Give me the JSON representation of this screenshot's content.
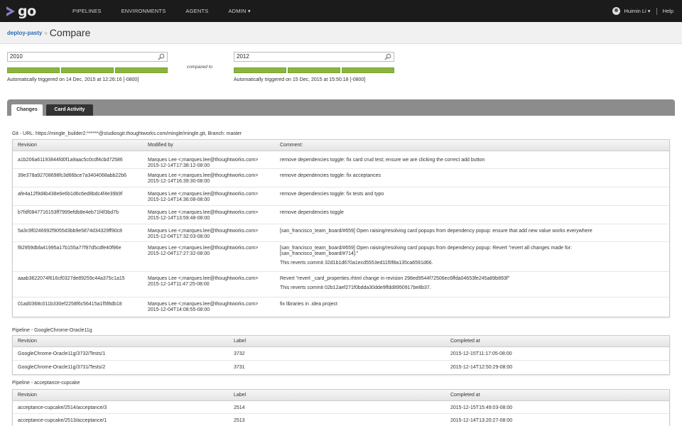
{
  "nav": {
    "logo_text": "go",
    "items": [
      "PIPELINES",
      "ENVIRONMENTS",
      "AGENTS",
      "ADMIN ▾"
    ],
    "user_name": "Huimin Li ▾",
    "help": "Help"
  },
  "header": {
    "breadcrumb": "deploy-pasty",
    "separator": "»",
    "title": "Compare"
  },
  "compare": {
    "left": {
      "value": "2010",
      "triggered": "Automatically triggered on 14 Dec, 2015 at 12:26:16 [-0800]"
    },
    "middle_label": "compared to",
    "right": {
      "value": "2012",
      "triggered": "Automatically triggered on 15 Dec, 2015 at 15:50:18 [-0800]"
    },
    "stage_color": "#8bb53e"
  },
  "tabs": [
    "Changes",
    "Card Activity"
  ],
  "git": {
    "label": "Git - URL: https://mingle_builder2:******@studiosgit.thoughtworks.com/mingle/mingle.git, Branch: master",
    "headers": [
      "Revision",
      "Modified by",
      "Comment:"
    ],
    "rows": [
      {
        "rev": "a1b206a61193844fd0f1a9aac5c0cdf4cbd72586",
        "by": "Marques Lee <;marques.lee@thoughtworks.com>",
        "date": "2015-12-14T17:38:12-08:00",
        "comment": "remove dependencies toggle: fix card crud test; ensure we are clicking the correct add button",
        "extra": ""
      },
      {
        "rev": "39e378a92708698fc3d66bce7a3404068abb22b6",
        "by": "Marques Lee <;marques.lee@thoughtworks.com>",
        "date": "2015-12-14T16:39:30-08:00",
        "comment": "remove dependencies toggle: fix acceptances",
        "extra": ""
      },
      {
        "rev": "afe4a12f9d4b438e6e6b1d6c6ed8bdc4f4e39b9f",
        "by": "Marques Lee <;marques.lee@thoughtworks.com>",
        "date": "2015-12-14T14:36:08-08:00",
        "comment": "remove dependencies toggle: fix tests and typo",
        "extra": ""
      },
      {
        "rev": "b7fdf0847716153ff7999efdb8e4eb71f4f3bd7b",
        "by": "Marques Lee <;marques.lee@thoughtworks.com>",
        "date": "2015-12-14T13:59:48-08:00",
        "comment": "remove dependencies toggle",
        "extra": ""
      },
      {
        "rev": "5a3c9f0246992f9055d3bb9e5874d34329ff90c8",
        "by": "Marques Lee <;marques.lee@thoughtworks.com>",
        "date": "2015-12-04T17:32:03-08:00",
        "comment": "[san_francisco_team_board/#659] Open raising/resolving card popups from dependency popup: ensure that add new value works everywhere",
        "extra": ""
      },
      {
        "rev": "f82959dbfa41995a17b155a77f97d5cdfe40f96e",
        "by": "Marques Lee <;marques.lee@thoughtworks.com>",
        "date": "2015-12-04T17:27:32-08:00",
        "comment": "[san_francisco_team_board/#659] Open raising/resolving card popups from dependency popup: Revert \"revert all changes made for: [san_francisco_team_board/#714]:\"",
        "extra": "This reverts commit 32d1b1d670a1ecd5553ed11f0f8a135ca6591d66."
      },
      {
        "rev": "aaab3622074f616cf0327de89259c44a375c1a15",
        "by": "Marques Lee <;marques.lee@thoughtworks.com>",
        "date": "2015-12-14T11:47:25-08:00",
        "comment": "Revert \"revert _card_properties.rhtml change in revision 298ed9544f72506ec6ffda04653fe245a89b893f\"",
        "extra": "This reverts commit 02b12aef271f0bdda30dde9ffdd8950917be8b37."
      },
      {
        "rev": "01ad0368c011b330ef2258f6c56415a1f5f8db18",
        "by": "Marques Lee <;marques.lee@thoughtworks.com>",
        "date": "2015-12-04T14:08:55-08:00",
        "comment": "fix libraries in .idea project",
        "extra": ""
      }
    ]
  },
  "pipeline1": {
    "label": "Pipeline - GoogleChrome-Oracle11g",
    "headers": [
      "Revision",
      "Label",
      "Completed at"
    ],
    "rows": [
      {
        "rev": "GoogleChrome-Oracle11g/3732/Tests/1",
        "label": "3732",
        "completed": "2015-12-15T11:17:05-08:00"
      },
      {
        "rev": "GoogleChrome-Oracle11g/3731/Tests/2",
        "label": "3731",
        "completed": "2015-12-14T12:50:29-08:00"
      }
    ]
  },
  "pipeline2": {
    "label": "Pipeline - acceptance-cupcake",
    "headers": [
      "Revision",
      "Label",
      "Completed at"
    ],
    "rows": [
      {
        "rev": "acceptance-cupcake/2514/acceptance/3",
        "label": "2514",
        "completed": "2015-12-15T15:49:03-08:00"
      },
      {
        "rev": "acceptance-cupcake/2513/acceptance/1",
        "label": "2513",
        "completed": "2015-12-14T13:20:27-08:00"
      }
    ]
  }
}
